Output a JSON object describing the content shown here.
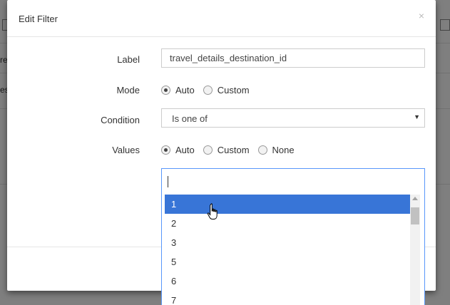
{
  "background": {
    "fragments": [
      "re",
      "es"
    ]
  },
  "modal": {
    "title": "Edit Filter",
    "close_glyph": "×",
    "label_field": {
      "label": "Label",
      "value": "travel_details_destination_id"
    },
    "mode": {
      "label": "Mode",
      "options": [
        "Auto",
        "Custom"
      ],
      "selected": "Auto"
    },
    "condition": {
      "label": "Condition",
      "selected": "Is one of",
      "caret": "▼"
    },
    "values": {
      "label": "Values",
      "options": [
        "Auto",
        "Custom",
        "None"
      ],
      "selected": "Auto"
    },
    "dropdown": {
      "search_value": "",
      "items": [
        "1",
        "2",
        "3",
        "5",
        "6",
        "7"
      ],
      "highlighted": "1"
    }
  },
  "colors": {
    "highlight": "#3875d7",
    "focus_border": "#5897fb"
  },
  "icons": {
    "close": "close-icon",
    "caret": "chevron-down-icon",
    "cursor": "hand-pointer-icon"
  }
}
